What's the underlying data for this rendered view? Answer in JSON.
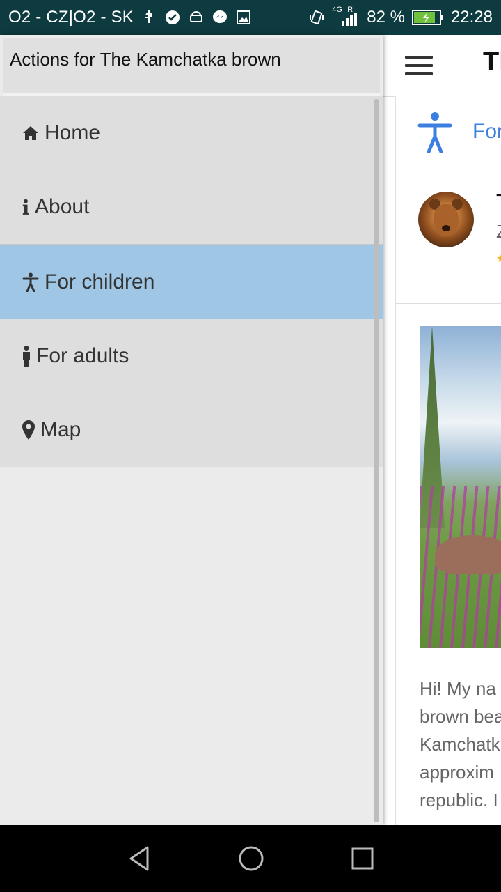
{
  "status_bar": {
    "carrier": "O2 - CZ|O2 - SK",
    "network": "4G",
    "roaming": "R",
    "battery": "82 %",
    "time": "22:28"
  },
  "app_bar": {
    "title_partial": "Tl"
  },
  "content": {
    "category_label": "For",
    "profile_initial": "T",
    "profile_sub": "Z",
    "story_lines": [
      "Hi! My na",
      "brown bea",
      "Kamchatk",
      "approxim",
      "republic. I"
    ]
  },
  "drawer": {
    "header_title": "Actions for The Kamchatka brown",
    "items": [
      {
        "label": "Home",
        "icon": "home-icon"
      },
      {
        "label": "About",
        "icon": "info-icon"
      },
      {
        "label": "For children",
        "icon": "child-icon"
      },
      {
        "label": "For adults",
        "icon": "person-icon"
      },
      {
        "label": "Map",
        "icon": "map-marker-icon"
      }
    ],
    "active_index": 2
  },
  "colors": {
    "status_bar_bg": "#0d3b40",
    "drawer_bg": "#ebebeb",
    "menu_item_bg": "#dedede",
    "active_item_bg": "#9fc6e5",
    "accent_blue": "#3b7fe0"
  }
}
